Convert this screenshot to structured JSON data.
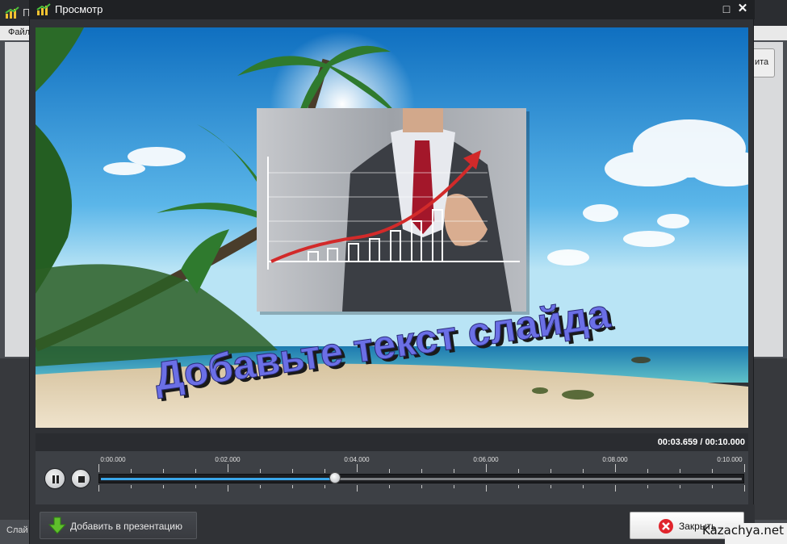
{
  "background_app": {
    "menu_label": "Файл",
    "right_button_label": "ита",
    "status_label": "Слай",
    "title_partial": "П"
  },
  "dialog": {
    "title": "Просмотр",
    "maximize_glyph": "□",
    "close_glyph": "✕"
  },
  "slide": {
    "text": "Добавьте текст слайда"
  },
  "playback": {
    "time_display": "00:03.659 / 00:10.000",
    "current_seconds": 3.659,
    "total_seconds": 10.0,
    "ruler_labels": [
      "0:00.000",
      "0:02.000",
      "0:04.000",
      "0:06.000",
      "0:08.000",
      "0:10.000"
    ]
  },
  "buttons": {
    "add_label": "Добавить в презентацию",
    "close_label": "Закрыть"
  },
  "watermark": "Kazachya.net",
  "colors": {
    "accent": "#3aa6e9",
    "slide_text": "#6b6fe6",
    "close_icon": "#e0242c",
    "add_icon": "#5fbf2c"
  }
}
